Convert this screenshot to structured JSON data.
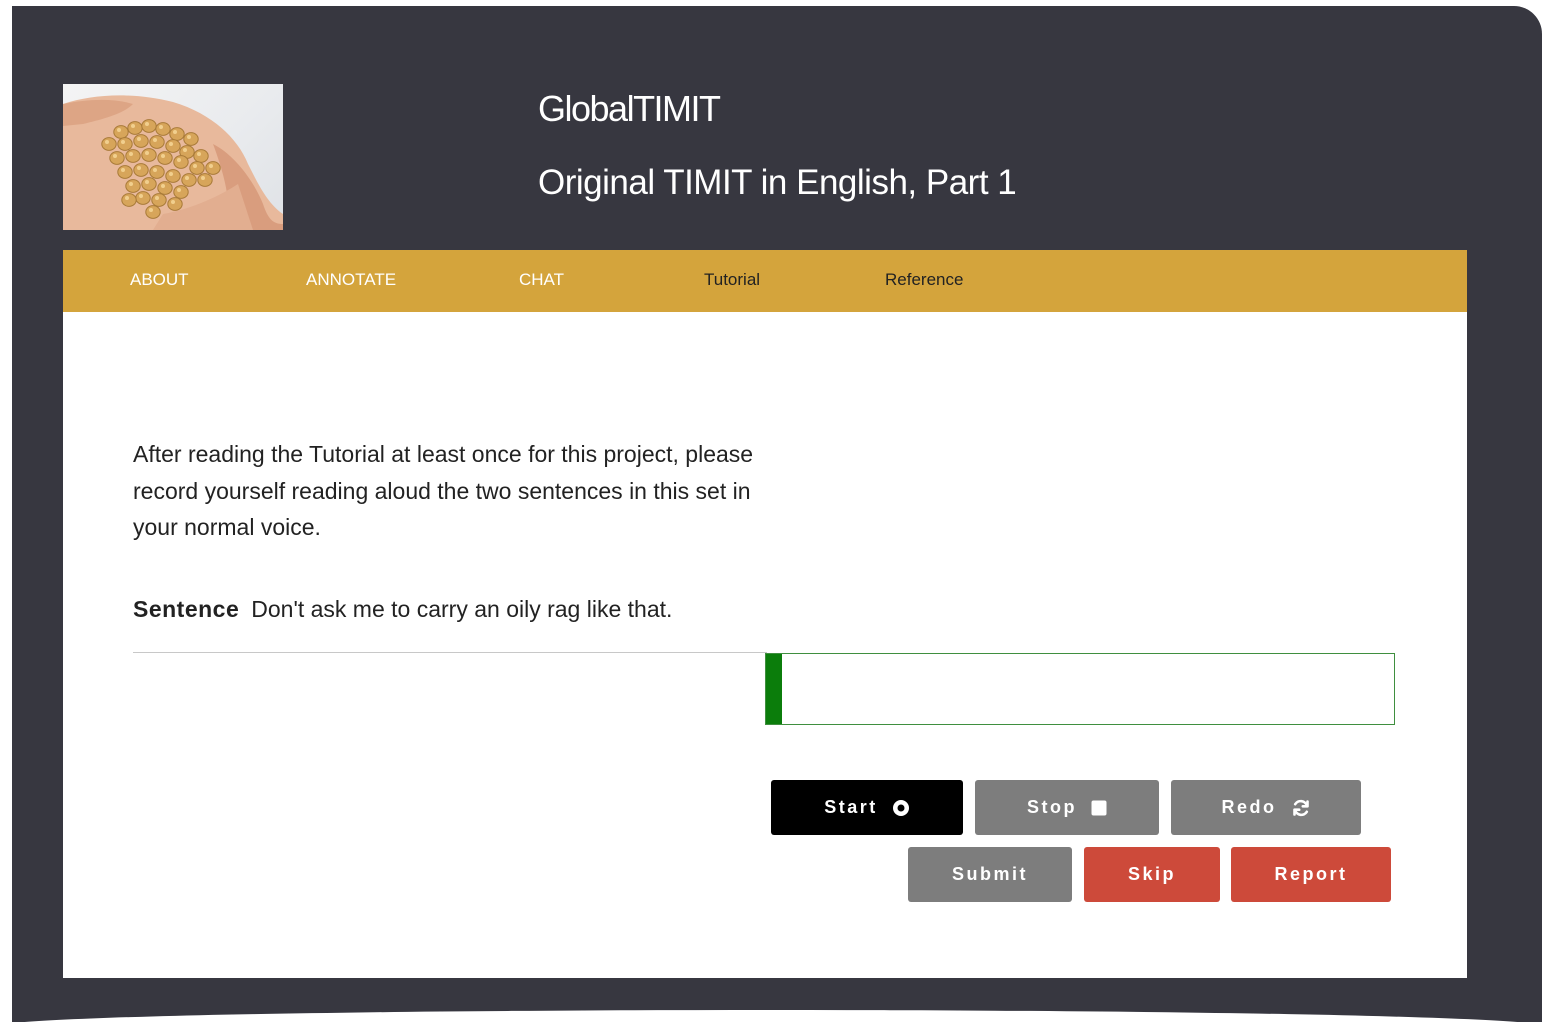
{
  "header": {
    "title": "GlobalTIMIT",
    "subtitle": "Original TIMIT in English, Part 1",
    "logo_icon": "chickpeas-in-hand-image"
  },
  "nav": {
    "items": [
      {
        "label": "ABOUT"
      },
      {
        "label": "ANNOTATE"
      },
      {
        "label": "CHAT"
      },
      {
        "label": "Tutorial"
      },
      {
        "label": "Reference"
      }
    ]
  },
  "task": {
    "instructions": "After reading the Tutorial at least once for this project, please record yourself reading aloud the two sentences in this set in your normal voice.",
    "sentence_label": "Sentence",
    "sentence_text": "Don't ask me to carry an oily rag like that."
  },
  "recorder": {
    "level": 0.025,
    "start_label": "Start",
    "start_icon": "record-icon",
    "stop_label": "Stop",
    "stop_icon": "stop-icon",
    "redo_label": "Redo",
    "redo_icon": "refresh-icon"
  },
  "actions": {
    "submit_label": "Submit",
    "skip_label": "Skip",
    "report_label": "Report"
  },
  "colors": {
    "frame": "#373740",
    "navbar": "#d4a43c",
    "meter_green": "#0b7d0b",
    "button_red": "#cd4a3a",
    "button_grey": "#7d7d7d"
  }
}
